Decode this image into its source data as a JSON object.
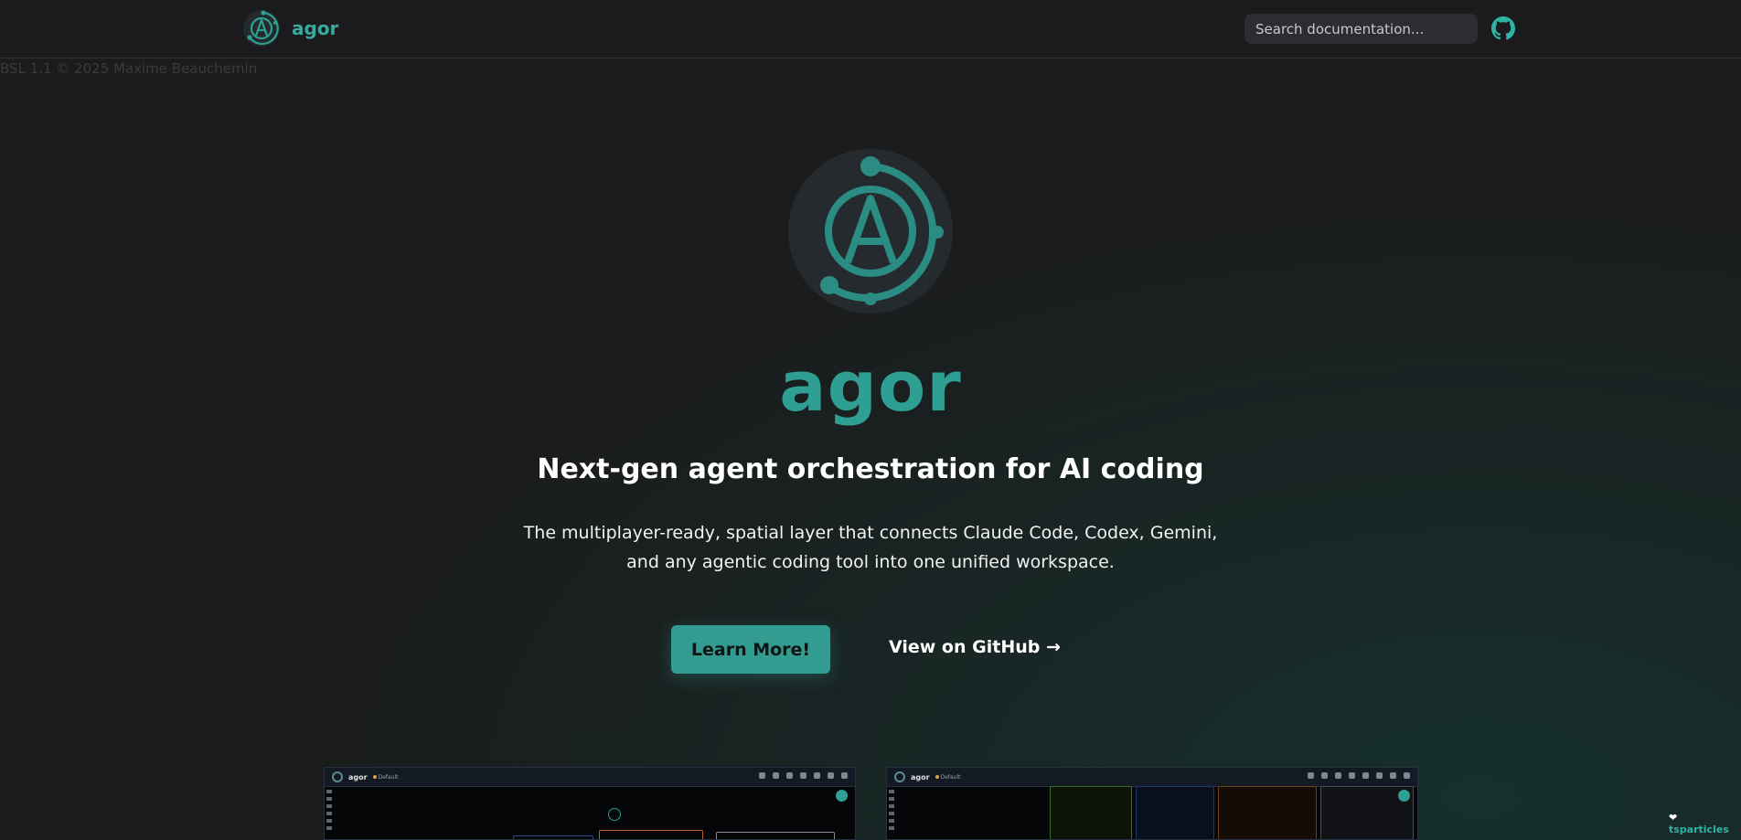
{
  "navbar": {
    "brand": "agor",
    "search_placeholder": "Search documentation...",
    "github_icon": "github-icon"
  },
  "copyright": "BSL 1.1 © 2025 Maxime Beauchemin",
  "hero": {
    "title": "agor",
    "tagline": "Next-gen agent orchestration for AI coding",
    "description": "The multiplayer-ready, spatial layer that connects Claude Code, Codex, Gemini, and any agentic coding tool into one unified workspace.",
    "primary_button": "Learn More!",
    "secondary_link": "View on GitHub →"
  },
  "screenshots": [
    {
      "app_name": "agor",
      "board": "Default"
    },
    {
      "app_name": "agor",
      "board": "Default"
    }
  ],
  "footer_badge": {
    "icon": "heart-icon",
    "label": "tsparticles"
  },
  "colors": {
    "accent": "#339c91",
    "background": "#1b1b1d",
    "title": "#2f9e93"
  }
}
